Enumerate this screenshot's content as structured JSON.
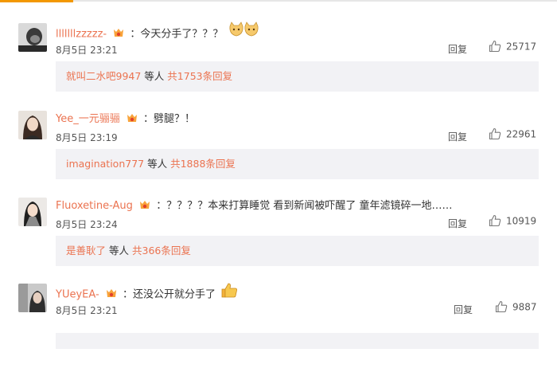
{
  "comments": [
    {
      "username": "lllllllzzzzz-",
      "text": "：今天分手了？？？",
      "date": "8月5日 23:21",
      "reply_label": "回复",
      "likes": "25717",
      "replies": {
        "users": "就叫二水吧9947",
        "middle": "等人",
        "count": "共1753条回复"
      }
    },
    {
      "username": "Yee_一元骊骊",
      "text": "：劈腿？！",
      "date": "8月5日 23:19",
      "reply_label": "回复",
      "likes": "22961",
      "replies": {
        "users": "imagination777",
        "middle": "等人",
        "count": "共1888条回复"
      }
    },
    {
      "username": "Fluoxetine-Aug",
      "text": "：？？？？本来打算睡觉 看到新闻被吓醒了 童年滤镜碎一地……",
      "date": "8月5日 23:24",
      "reply_label": "回复",
      "likes": "10919",
      "replies": {
        "users": "是善耿了",
        "middle": "等人",
        "count": "共366条回复"
      }
    },
    {
      "username": "YUeyEA-",
      "text": "：还没公开就分手了",
      "date": "8月5日 23:21",
      "reply_label": "回复",
      "likes": "9887",
      "replies": {
        "users": "",
        "middle": "",
        "count": ""
      }
    }
  ]
}
